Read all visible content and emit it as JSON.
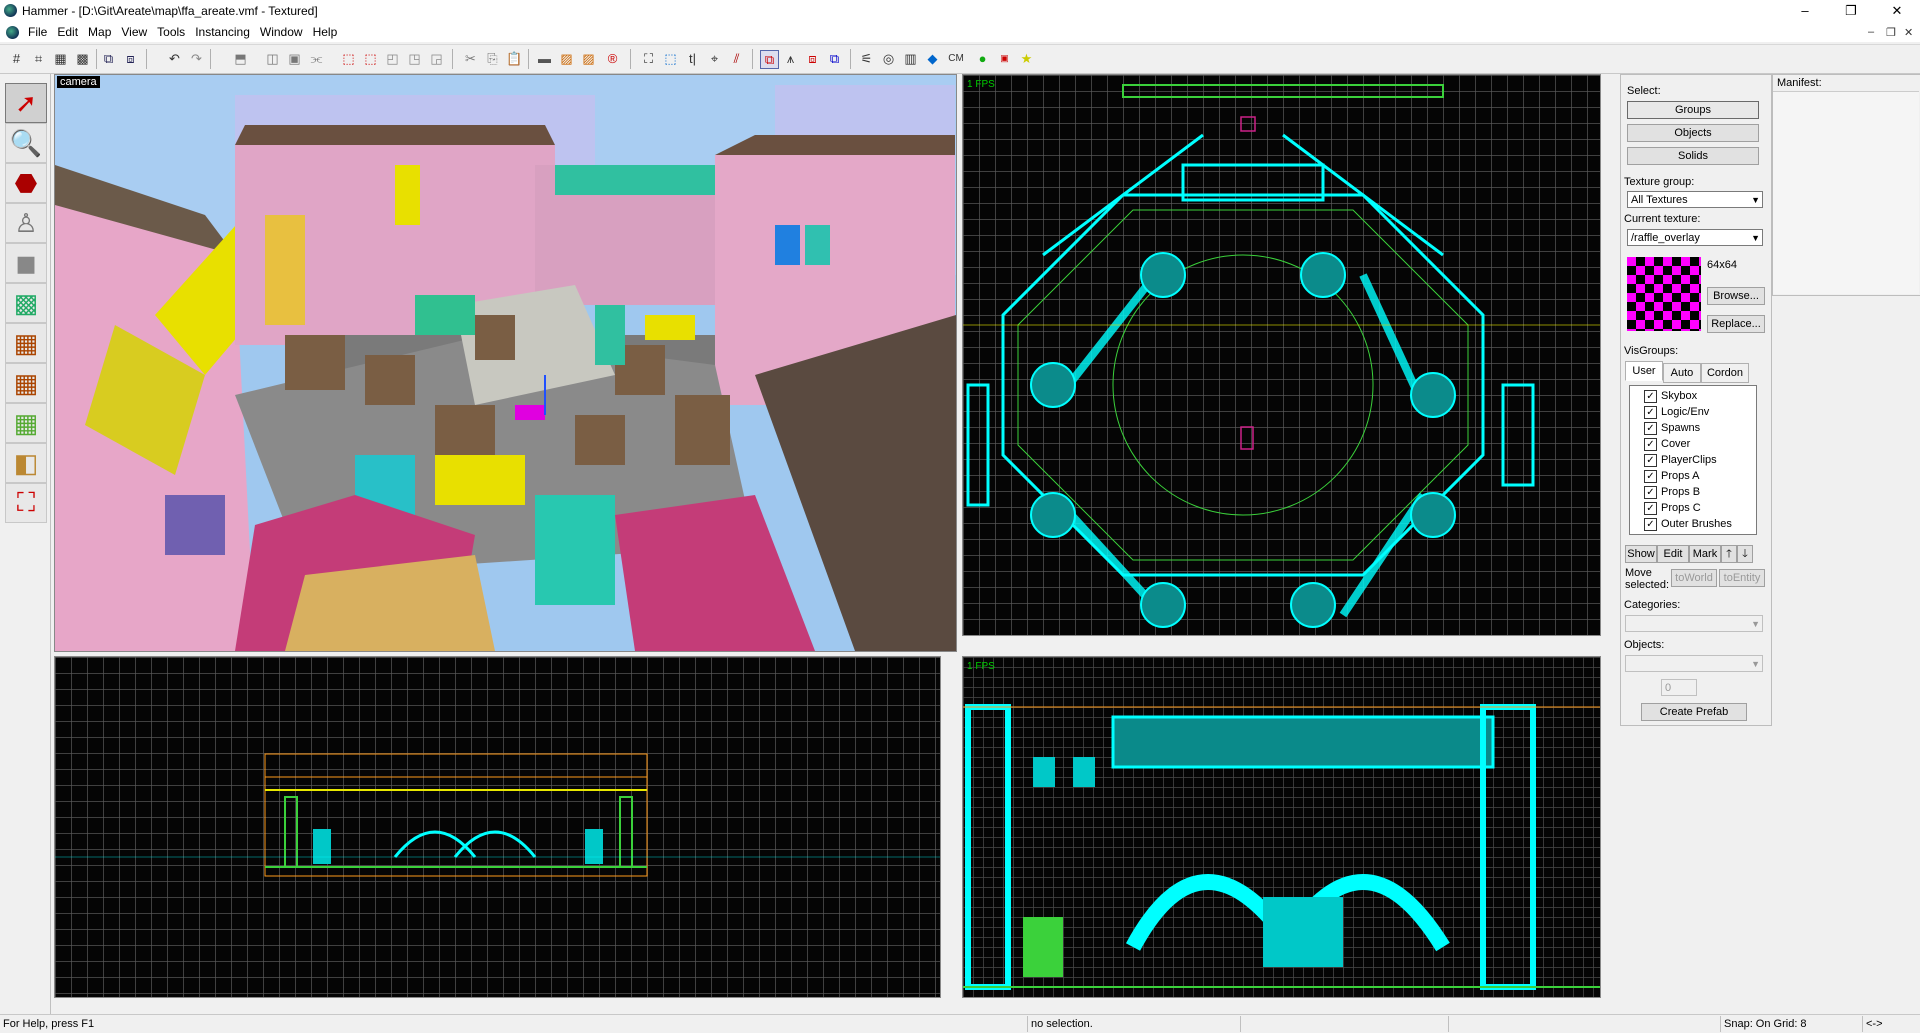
{
  "window": {
    "title": "Hammer - [D:\\Git\\Areate\\map\\ffa_areate.vmf - Textured]",
    "minimize": "–",
    "maximize": "❐",
    "close": "✕"
  },
  "menu": {
    "items": [
      "File",
      "Edit",
      "Map",
      "View",
      "Tools",
      "Instancing",
      "Window",
      "Help"
    ],
    "mdi_minimize": "–",
    "mdi_restore": "❐",
    "mdi_close": "✕"
  },
  "toolbar": {
    "cm_label": "CM"
  },
  "viewports": {
    "camera": {
      "label": "camera"
    },
    "top": {
      "fps": "1 FPS"
    },
    "front": {
      "fps": "1 FPS"
    }
  },
  "select_panel": {
    "select_label": "Select:",
    "groups": "Groups",
    "objects": "Objects",
    "solids": "Solids"
  },
  "texture_panel": {
    "group_label": "Texture group:",
    "group_value": "All Textures",
    "current_label": "Current texture:",
    "current_value": "/raffle_overlay",
    "size": "64x64",
    "browse": "Browse...",
    "replace": "Replace...",
    "preview_colors": [
      "#ff00ff",
      "#000000"
    ]
  },
  "visgroups": {
    "label": "VisGroups:",
    "tabs": [
      "User",
      "Auto",
      "Cordon"
    ],
    "items": [
      "Skybox",
      "Logic/Env",
      "Spawns",
      "Cover",
      "PlayerClips",
      "Props A",
      "Props B",
      "Props C",
      "Outer Brushes"
    ],
    "show": "Show",
    "edit": "Edit",
    "mark": "Mark",
    "up": "🡑",
    "down": "🡓",
    "move_selected": "Move selected:",
    "to_world": "toWorld",
    "to_entity": "toEntity"
  },
  "prefab": {
    "categories_label": "Categories:",
    "objects_label": "Objects:",
    "count": "0",
    "create": "Create Prefab"
  },
  "manifest": {
    "label": "Manifest:"
  },
  "status": {
    "help": "For Help, press F1",
    "selection": "no selection.",
    "snap": "Snap: On Grid: 8",
    "arrows": "<->"
  },
  "colors": {
    "grid_cyan": "#00ffff",
    "grid_green": "#3bd13b",
    "grid_orange": "#ff9a1a",
    "grid_yellow": "#e8e800",
    "fps_green": "#00cc00"
  }
}
